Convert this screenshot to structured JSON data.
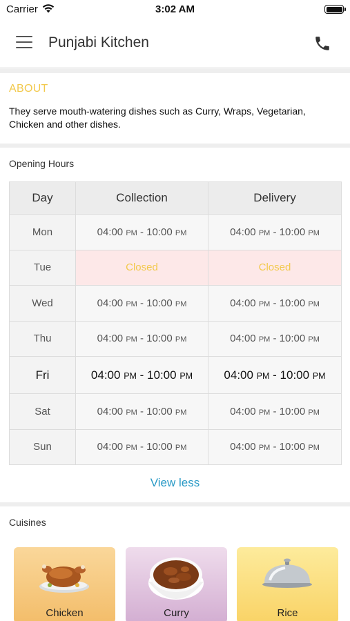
{
  "status_bar": {
    "carrier": "Carrier",
    "time": "3:02 AM"
  },
  "header": {
    "title": "Punjabi Kitchen",
    "menu_icon": "hamburger-menu-icon",
    "phone_icon": "phone-icon"
  },
  "about": {
    "heading": "ABOUT",
    "text": "They serve mouth-watering dishes such as Curry, Wraps, Vegetarian, Chicken and other dishes."
  },
  "opening_hours": {
    "title": "Opening Hours",
    "columns": [
      "Day",
      "Collection",
      "Delivery"
    ],
    "rows": [
      {
        "day": "Mon",
        "collection": {
          "open": "04:00",
          "open_ampm": "PM",
          "close": "10:00",
          "close_ampm": "PM"
        },
        "delivery": {
          "open": "04:00",
          "open_ampm": "PM",
          "close": "10:00",
          "close_ampm": "PM"
        }
      },
      {
        "day": "Tue",
        "closed": true,
        "collection_text": "Closed",
        "delivery_text": "Closed"
      },
      {
        "day": "Wed",
        "collection": {
          "open": "04:00",
          "open_ampm": "PM",
          "close": "10:00",
          "close_ampm": "PM"
        },
        "delivery": {
          "open": "04:00",
          "open_ampm": "PM",
          "close": "10:00",
          "close_ampm": "PM"
        }
      },
      {
        "day": "Thu",
        "collection": {
          "open": "04:00",
          "open_ampm": "PM",
          "close": "10:00",
          "close_ampm": "PM"
        },
        "delivery": {
          "open": "04:00",
          "open_ampm": "PM",
          "close": "10:00",
          "close_ampm": "PM"
        }
      },
      {
        "day": "Fri",
        "today": true,
        "collection": {
          "open": "04:00",
          "open_ampm": "PM",
          "close": "10:00",
          "close_ampm": "PM"
        },
        "delivery": {
          "open": "04:00",
          "open_ampm": "PM",
          "close": "10:00",
          "close_ampm": "PM"
        }
      },
      {
        "day": "Sat",
        "collection": {
          "open": "04:00",
          "open_ampm": "PM",
          "close": "10:00",
          "close_ampm": "PM"
        },
        "delivery": {
          "open": "04:00",
          "open_ampm": "PM",
          "close": "10:00",
          "close_ampm": "PM"
        }
      },
      {
        "day": "Sun",
        "collection": {
          "open": "04:00",
          "open_ampm": "PM",
          "close": "10:00",
          "close_ampm": "PM"
        },
        "delivery": {
          "open": "04:00",
          "open_ampm": "PM",
          "close": "10:00",
          "close_ampm": "PM"
        }
      }
    ],
    "view_less": "View less"
  },
  "cuisines": {
    "title": "Cuisines",
    "items": [
      {
        "label": "Chicken",
        "image": "roast-chicken-image"
      },
      {
        "label": "Curry",
        "image": "curry-bowl-image"
      },
      {
        "label": "Rice",
        "image": "silver-cloche-image"
      }
    ]
  },
  "colors": {
    "accent_yellow": "#f2c94c",
    "link_blue": "#2a9ac6",
    "closed_bg": "#fde8e8",
    "chicken_card": "#f7cf84",
    "curry_card": "#e2c6e0",
    "rice_card": "#fbe089"
  }
}
